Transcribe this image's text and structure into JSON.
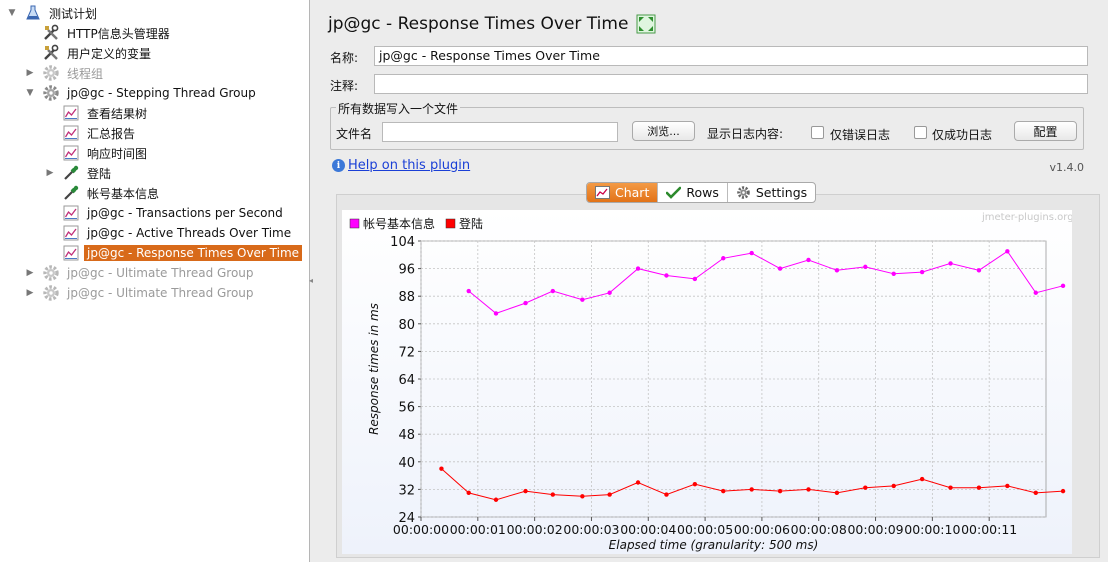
{
  "tree": {
    "items": [
      {
        "label": "测试计划",
        "level": 0,
        "toggle": "▼",
        "icon": "flask-icon",
        "state": "normal"
      },
      {
        "label": "HTTP信息头管理器",
        "level": 1,
        "toggle": "",
        "icon": "tools-icon",
        "state": "normal"
      },
      {
        "label": "用户定义的变量",
        "level": 1,
        "toggle": "",
        "icon": "tools-icon",
        "state": "normal"
      },
      {
        "label": "线程组",
        "level": 1,
        "toggle": "▶",
        "icon": "gear-icon",
        "state": "disabled"
      },
      {
        "label": "jp@gc - Stepping Thread Group",
        "level": 1,
        "toggle": "▼",
        "icon": "gear-icon",
        "state": "normal"
      },
      {
        "label": "查看结果树",
        "level": 2,
        "toggle": "",
        "icon": "chart-icon",
        "state": "normal"
      },
      {
        "label": "汇总报告",
        "level": 2,
        "toggle": "",
        "icon": "chart-icon",
        "state": "normal"
      },
      {
        "label": "响应时间图",
        "level": 2,
        "toggle": "",
        "icon": "chart-icon",
        "state": "normal"
      },
      {
        "label": "登陆",
        "level": 2,
        "toggle": "▶",
        "icon": "pipette-icon",
        "state": "normal"
      },
      {
        "label": "帐号基本信息",
        "level": 2,
        "toggle": "",
        "icon": "pipette-icon",
        "state": "normal"
      },
      {
        "label": "jp@gc - Transactions per Second",
        "level": 2,
        "toggle": "",
        "icon": "chart-icon",
        "state": "normal"
      },
      {
        "label": "jp@gc - Active Threads Over Time",
        "level": 2,
        "toggle": "",
        "icon": "chart-icon",
        "state": "normal"
      },
      {
        "label": "jp@gc - Response Times Over Time",
        "level": 2,
        "toggle": "",
        "icon": "chart-icon",
        "state": "selected"
      },
      {
        "label": "jp@gc - Ultimate Thread Group",
        "level": 1,
        "toggle": "▶",
        "icon": "gear-icon",
        "state": "disabled"
      },
      {
        "label": "jp@gc - Ultimate Thread Group",
        "level": 1,
        "toggle": "▶",
        "icon": "gear-icon",
        "state": "disabled"
      }
    ]
  },
  "header": {
    "title": "jp@gc - Response Times Over Time"
  },
  "form": {
    "name_label": "名称:",
    "name_value": "jp@gc - Response Times Over Time",
    "comment_label": "注释:",
    "comment_value": "",
    "file_group_title": "所有数据写入一个文件",
    "filename_label": "文件名",
    "filename_value": "",
    "browse_label": "浏览...",
    "log_label": "显示日志内容:",
    "errors_only_label": "仅错误日志",
    "success_only_label": "仅成功日志",
    "configure_label": "配置"
  },
  "help": {
    "link_text": "Help on this plugin",
    "version": "v1.4.0"
  },
  "tabs": [
    {
      "label": "Chart",
      "icon": "chart-tab-icon",
      "active": true
    },
    {
      "label": "Rows",
      "icon": "checkmark-icon",
      "active": false
    },
    {
      "label": "Settings",
      "icon": "settings-gear-icon",
      "active": false
    }
  ],
  "colors": {
    "accent": "#e27318",
    "series1": "#ff00ff",
    "series2": "#ff0000",
    "link": "#1a3fd6"
  },
  "chart_data": {
    "type": "line",
    "watermark": "jmeter-plugins.org",
    "xlabel": "Elapsed time (granularity: 500 ms)",
    "ylabel": "Response times in ms",
    "ylim": [
      24,
      104
    ],
    "yticks": [
      24,
      32,
      40,
      48,
      56,
      64,
      72,
      80,
      88,
      96,
      104
    ],
    "xlim": [
      0,
      11
    ],
    "xticks": [
      "00:00:00",
      "00:00:01",
      "00:00:02",
      "00:00:03",
      "00:00:04",
      "00:00:05",
      "00:00:06",
      "00:00:08",
      "00:00:09",
      "00:00:10",
      "00:00:11"
    ],
    "grid": true,
    "legend_position": "top-left",
    "series": [
      {
        "name": "帐号基本信息",
        "color": "#ff00ff",
        "x": [
          0.84,
          1.32,
          1.84,
          2.32,
          2.84,
          3.32,
          3.82,
          4.32,
          4.82,
          5.32,
          5.82,
          6.32,
          6.82,
          7.32,
          7.82,
          8.32,
          8.82,
          9.32,
          9.82,
          10.32,
          10.82,
          11.3
        ],
        "y": [
          89.5,
          83,
          86,
          89.5,
          87,
          89,
          96,
          94,
          93,
          99,
          100.5,
          96,
          98.5,
          95.5,
          96.5,
          94.5,
          95,
          97.5,
          95.5,
          101,
          89,
          91
        ]
      },
      {
        "name": "登陆",
        "color": "#ff0000",
        "x": [
          0.36,
          0.84,
          1.32,
          1.84,
          2.32,
          2.84,
          3.32,
          3.82,
          4.32,
          4.82,
          5.32,
          5.82,
          6.32,
          6.82,
          7.32,
          7.82,
          8.32,
          8.82,
          9.32,
          9.82,
          10.32,
          10.82,
          11.3
        ],
        "y": [
          38,
          31,
          29,
          31.5,
          30.5,
          30,
          30.5,
          34,
          30.5,
          33.5,
          31.5,
          32,
          31.5,
          32,
          31,
          32.5,
          33,
          35,
          32.5,
          32.5,
          33,
          31,
          31.5
        ]
      }
    ]
  }
}
